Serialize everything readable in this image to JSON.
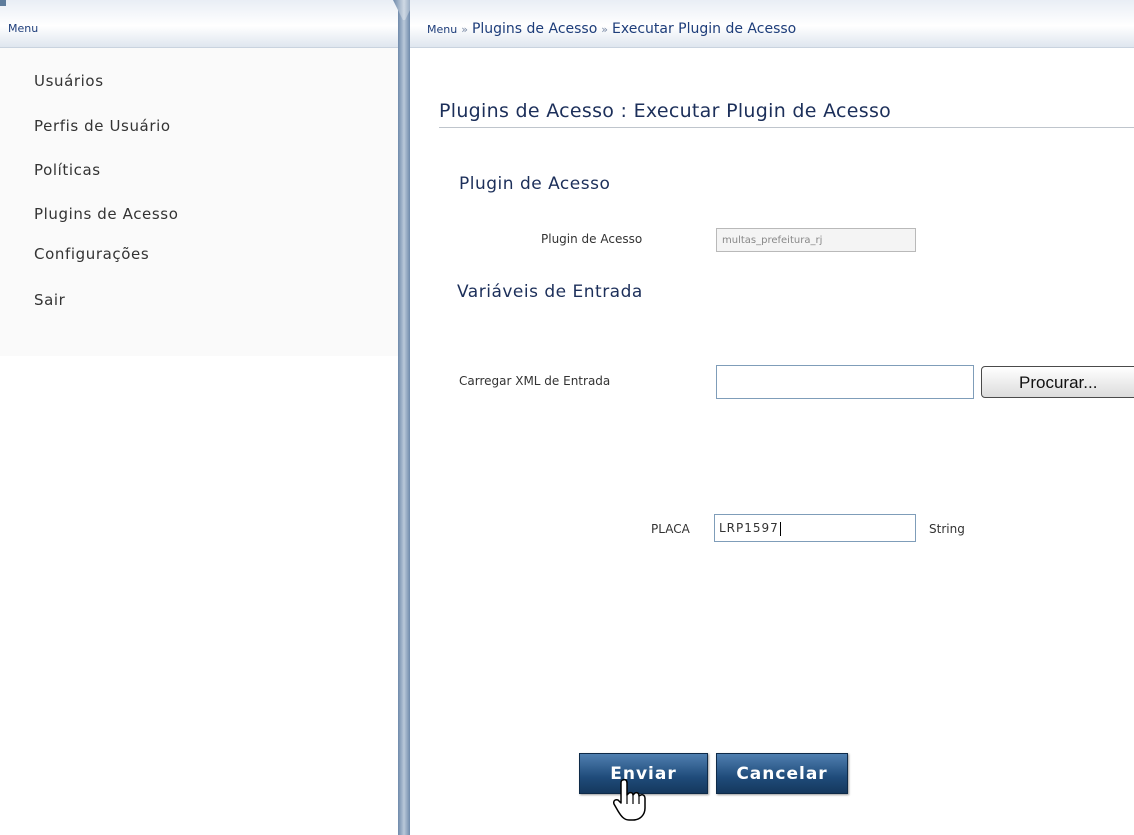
{
  "menu": {
    "header": "Menu",
    "items": [
      "Usuários",
      "Perfis de Usuário",
      "Políticas",
      "Plugins de Acesso",
      "Configurações",
      "Sair"
    ]
  },
  "breadcrumb": {
    "root": "Menu",
    "sep1": "»",
    "level1": "Plugins de Acesso",
    "sep2": "»",
    "level2": "Executar Plugin de Acesso"
  },
  "page_title": "Plugins de Acesso : Executar Plugin de Acesso",
  "plugin_section": {
    "heading": "Plugin de Acesso",
    "label": "Plugin de Acesso",
    "value": "multas_prefeitura_rj"
  },
  "input_vars": {
    "heading": "Variáveis de Entrada",
    "xml_label": "Carregar XML de Entrada",
    "xml_value": "",
    "browse_label": "Procurar...",
    "placa_label": "PLACA",
    "placa_value": "LRP1597",
    "placa_type": "String"
  },
  "actions": {
    "submit": "Enviar",
    "cancel": "Cancelar"
  },
  "colors": {
    "accent": "#1d3d7a",
    "button": "#1f4b7a"
  }
}
